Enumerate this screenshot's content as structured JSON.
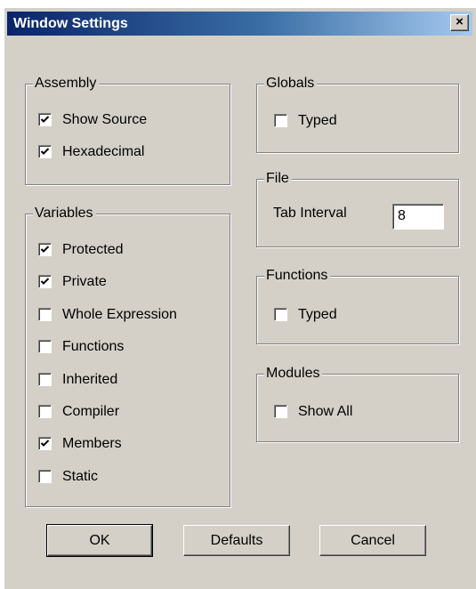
{
  "window": {
    "title": "Window Settings",
    "close_glyph": "×"
  },
  "assembly": {
    "title": "Assembly",
    "items": [
      {
        "label": "Show Source",
        "checked": true
      },
      {
        "label": "Hexadecimal",
        "checked": true
      }
    ]
  },
  "variables": {
    "title": "Variables",
    "items": [
      {
        "label": "Protected",
        "checked": true
      },
      {
        "label": "Private",
        "checked": true
      },
      {
        "label": "Whole Expression",
        "checked": false
      },
      {
        "label": "Functions",
        "checked": false
      },
      {
        "label": "Inherited",
        "checked": false
      },
      {
        "label": "Compiler",
        "checked": false
      },
      {
        "label": "Members",
        "checked": true
      },
      {
        "label": "Static",
        "checked": false
      }
    ]
  },
  "globals": {
    "title": "Globals",
    "items": [
      {
        "label": "Typed",
        "checked": false
      }
    ]
  },
  "file": {
    "title": "File",
    "tab_interval_label": "Tab Interval",
    "tab_interval_value": "8"
  },
  "functions": {
    "title": "Functions",
    "items": [
      {
        "label": "Typed",
        "checked": false
      }
    ]
  },
  "modules": {
    "title": "Modules",
    "items": [
      {
        "label": "Show All",
        "checked": false
      }
    ]
  },
  "buttons": {
    "ok": "OK",
    "defaults": "Defaults",
    "cancel": "Cancel"
  }
}
